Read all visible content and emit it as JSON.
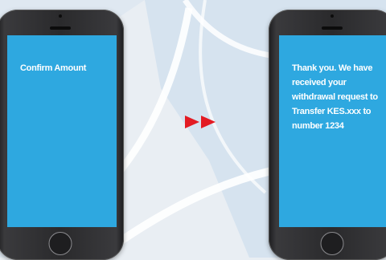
{
  "left_phone": {
    "screen_text": "Confirm Amount"
  },
  "right_phone": {
    "screen_text": "Thank you. We have received your withdrawal request to Transfer KES.xxx to number 1234"
  },
  "arrow_icon": "fast-forward-icon",
  "colors": {
    "screen": "#2ea8e0",
    "arrow": "#e31b23",
    "phone_body": "#2a2a2c",
    "background": "#e9eef3"
  }
}
